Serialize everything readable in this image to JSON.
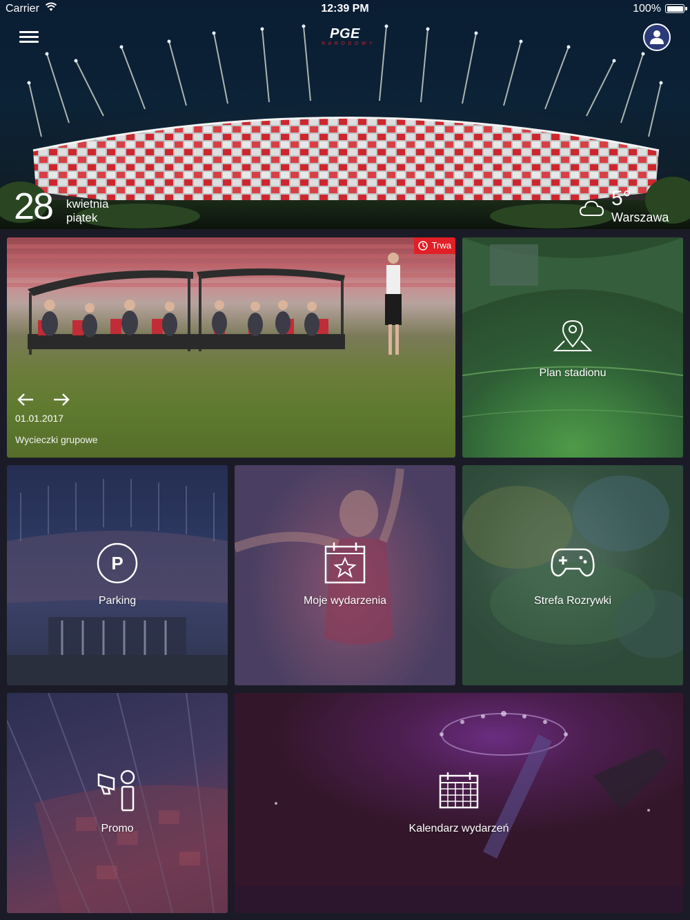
{
  "status_bar": {
    "carrier": "Carrier",
    "time": "12:39 PM",
    "battery": "100%"
  },
  "header": {
    "logo_main": "PGE",
    "logo_sub": "NARODOWY",
    "icons": {
      "menu": "hamburger-menu-icon",
      "profile": "user-icon"
    }
  },
  "hero": {
    "day": "28",
    "month": "kwietnia",
    "weekday": "piątek",
    "temperature": "5°",
    "city": "Warszawa",
    "weather_icon": "cloud-icon"
  },
  "featured": {
    "badge": "Trwa",
    "date": "01.01.2017",
    "title": "Wycieczki grupowe"
  },
  "tiles": {
    "plan": {
      "label": "Plan stadionu",
      "icon": "map-pin-icon"
    },
    "parking": {
      "label": "Parking",
      "icon": "parking-icon"
    },
    "moje": {
      "label": "Moje wydarzenia",
      "icon": "calendar-star-icon"
    },
    "strefa": {
      "label": "Strefa Rozrywki",
      "icon": "gamepad-icon"
    },
    "promo": {
      "label": "Promo",
      "icon": "megaphone-person-icon"
    },
    "kalendarz": {
      "label": "Kalendarz wydarzeń",
      "icon": "calendar-grid-icon"
    }
  },
  "colors": {
    "accent_red": "#e21f26",
    "background": "#1b1b27"
  }
}
